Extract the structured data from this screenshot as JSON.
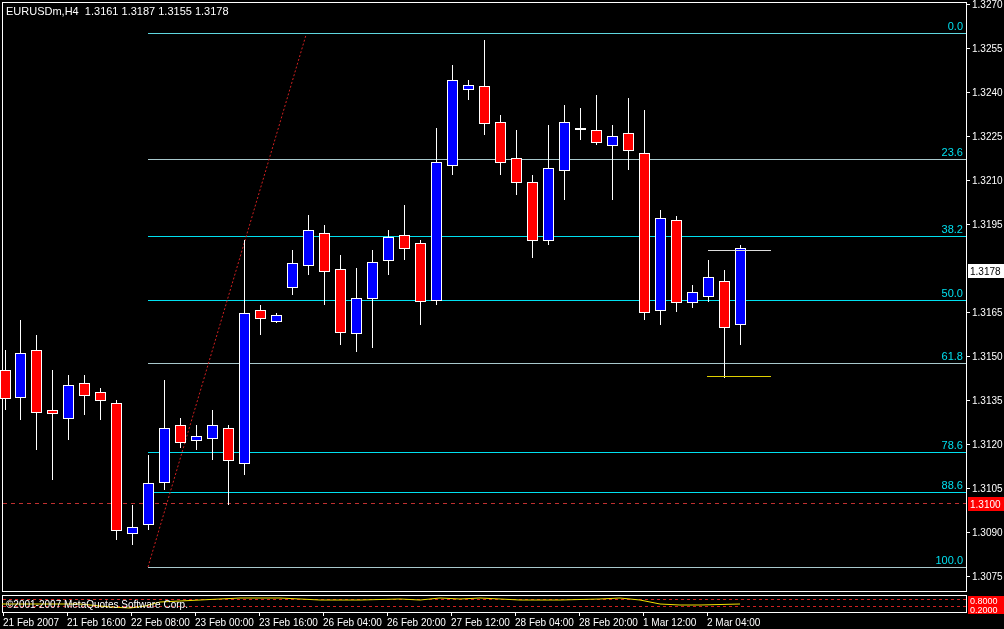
{
  "chart": {
    "title": "EURUSDm,H4  1.3161 1.3187 1.3155 1.3178",
    "fib_levels": [
      "0.0",
      "23.6",
      "38.2",
      "50.0",
      "61.8",
      "78.6",
      "88.6",
      "100.0"
    ],
    "price_axis": [
      "1.3270",
      "1.3255",
      "1.3240",
      "1.3225",
      "1.3210",
      "1.3195",
      "1.3165",
      "1.3150",
      "1.3135",
      "1.3120",
      "1.3105",
      "1.3090",
      "1.3075"
    ],
    "current_price": "1.3178",
    "alert_price": "1.3100",
    "time_axis": [
      "21 Feb 2007",
      "21 Feb 16:00",
      "22 Feb 08:00",
      "23 Feb 00:00",
      "23 Feb 16:00",
      "26 Feb 04:00",
      "26 Feb 20:00",
      "27 Feb 12:00",
      "28 Feb 04:00",
      "28 Feb 20:00",
      "1 Mar 12:00",
      "2 Mar 04:00"
    ]
  },
  "indicator": {
    "caption": "©2001-2007 MetaQuotes Software Corp.",
    "levels": [
      "0.8000",
      "0.2000"
    ]
  }
}
